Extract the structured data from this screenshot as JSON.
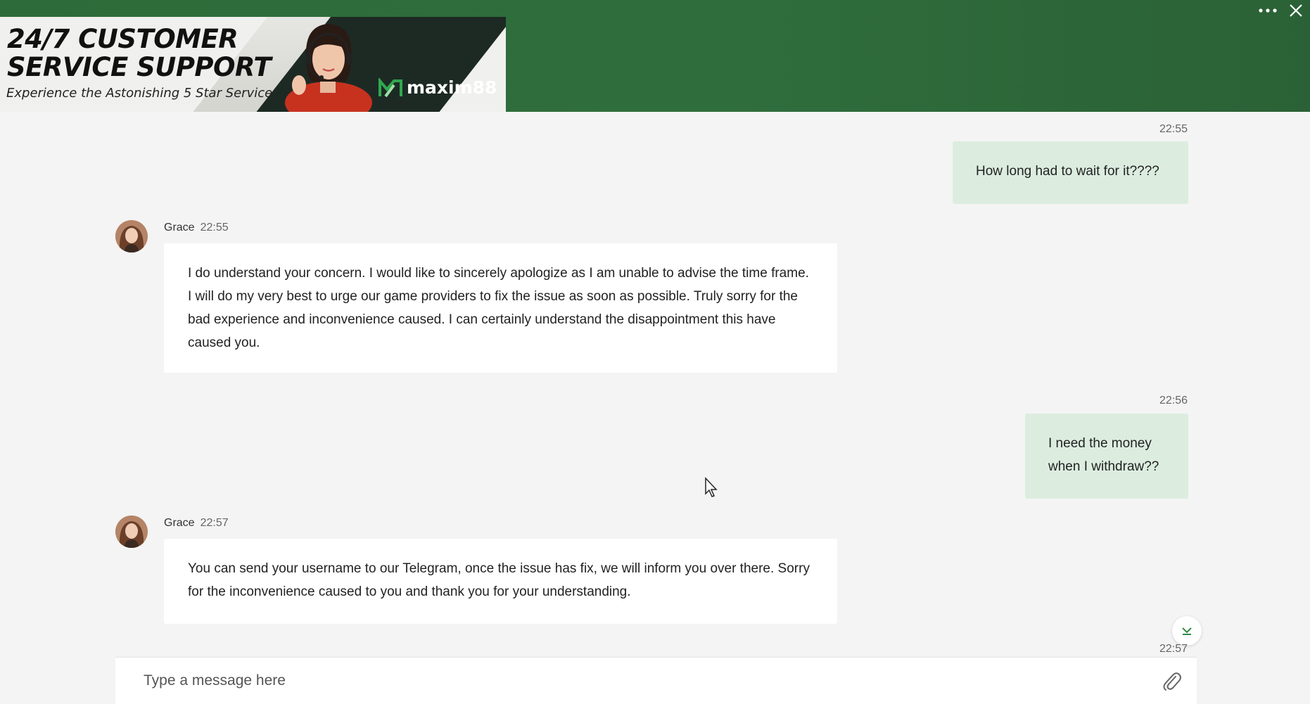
{
  "banner": {
    "title": "24/7 CUSTOMER\nSERVICE SUPPORT",
    "subtitle": "Experience the Astonishing 5 Star Service",
    "brand": "maxim88"
  },
  "header": {
    "menu_icon": "more-horizontal-icon",
    "close_icon": "close-icon"
  },
  "colors": {
    "header_green": "#2e6b3a",
    "user_bubble": "#dcede0",
    "agent_bubble": "#ffffff",
    "background": "#f4f4f4"
  },
  "messages": [
    {
      "sender": "user",
      "time": "22:55",
      "text": "How long had to wait for it????"
    },
    {
      "sender": "agent",
      "name": "Grace",
      "time": "22:55",
      "text": "I do understand your concern. I would like to sincerely apologize as I am unable to advise the time frame. I will do my very best to urge our game providers to fix the issue as soon as possible. Truly sorry for the bad experience and inconvenience caused. I can certainly understand the disappointment this have caused you."
    },
    {
      "sender": "user",
      "time": "22:56",
      "text": "I need the money when I withdraw??"
    },
    {
      "sender": "agent",
      "name": "Grace",
      "time": "22:57",
      "text": "You can send your username to our Telegram, once the issue has fix, we will inform you over there. Sorry for the inconvenience caused to you and thank you for your understanding."
    },
    {
      "sender": "user",
      "time": "22:57"
    }
  ],
  "composer": {
    "placeholder": "Type a message here",
    "attach_icon": "paperclip-icon"
  },
  "scroll_icon": "chevron-down-icon"
}
